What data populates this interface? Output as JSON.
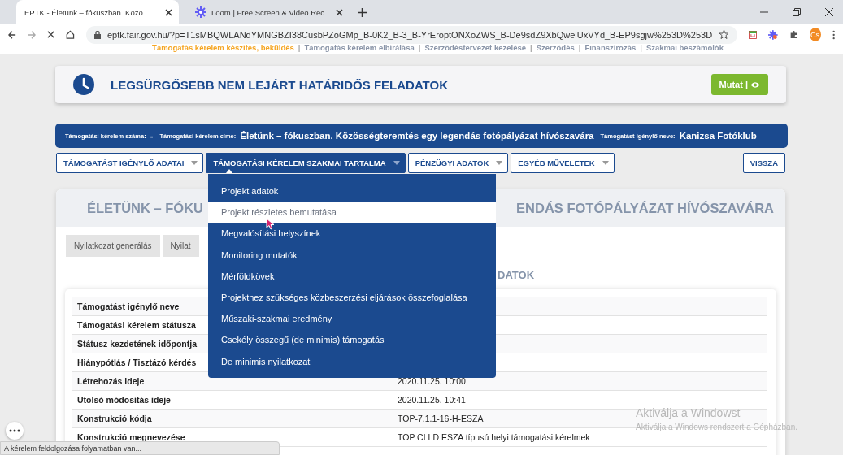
{
  "browser": {
    "tabs": [
      {
        "title": "EPTK - Életünk – fókuszban. Közö",
        "selected": true
      },
      {
        "title": "Loom | Free Screen & Video Rec",
        "selected": false
      }
    ],
    "url": "eptk.fair.gov.hu/?p=T1sMBQWLANdYMNGBZI38CusbPZoGMp_B-0K2_B-3_B-YrEroptONXoZWS_B-De9sdZ9XbQwelUxVYd_B-EP9sgjw%253D%253D",
    "profile": "Cs"
  },
  "nav_separator": "|",
  "nav_links": [
    {
      "label": "Támogatás kérelem készítés, beküldés",
      "selected": true
    },
    {
      "label": "Támogatás kérelem elbírálása",
      "selected": false
    },
    {
      "label": "Szerződéstervezet kezelése",
      "selected": false
    },
    {
      "label": "Szerződés",
      "selected": false
    },
    {
      "label": "Finanszírozás",
      "selected": false
    },
    {
      "label": "Szakmai beszámolók",
      "selected": false
    }
  ],
  "deadlines": {
    "title": "LEGSÜRGŐSEBB NEM LEJÁRT HATÁRIDŐS FELADATOK",
    "button": "Mutat |"
  },
  "info_bar": [
    {
      "label": "Támogatási kérelem száma:",
      "value": "-"
    },
    {
      "label": "Támogatási kérelem címe:",
      "value": "Életünk – fókuszban. Közösségteremtés egy legendás fotópályázat hívószavára"
    },
    {
      "label": "Támogatást igénylő neve:",
      "value": "Kanizsa Fotóklub"
    }
  ],
  "menu_tabs": [
    {
      "label": "TÁMOGATÁST IGÉNYLŐ ADATAI",
      "selected": false
    },
    {
      "label": "TÁMOGATÁSI KÉRELEM SZAKMAI TARTALMA",
      "selected": true
    },
    {
      "label": "PÉNZÜGYI ADATOK",
      "selected": false
    },
    {
      "label": "EGYÉB MŰVELETEK",
      "selected": false
    }
  ],
  "back_button": "VISSZA",
  "dropdown": [
    {
      "label": "Projekt adatok",
      "highlighted": false
    },
    {
      "label": "Projekt részletes bemutatása",
      "highlighted": true
    },
    {
      "label": "Megvalósítási helyszínek",
      "highlighted": false
    },
    {
      "label": "Monitoring mutatók",
      "highlighted": false
    },
    {
      "label": "Mérföldkövek",
      "highlighted": false
    },
    {
      "label": "Projekthez szükséges közbeszerzési eljárások összefoglalása",
      "highlighted": false
    },
    {
      "label": "Műszaki-szakmai eredmény",
      "highlighted": false
    },
    {
      "label": "Csekély összegű (de minimis) támogatás",
      "highlighted": false
    },
    {
      "label": "De minimis nyilatkozat",
      "highlighted": false
    }
  ],
  "main": {
    "title_start": "ÉLETÜNK – FÓKU",
    "title_end": "ENDÁS FOTÓPÁLYÁZAT HÍVÓSZAVÁRA",
    "sub_tabs": [
      "Nyilatkozat generálás",
      "Nyilat"
    ],
    "section_heading": "DATOK",
    "rows": [
      {
        "label": "Támogatást igénylő neve"
      },
      {
        "label": "Támogatási kérelem státusza"
      },
      {
        "label": "Státusz kezdetének időpontja"
      },
      {
        "label": "Hiánypótlás / Tisztázó kérdés"
      },
      {
        "label": "Létrehozás ideje",
        "value": "2020.11.25. 10:00"
      },
      {
        "label": "Utolsó módosítás ideje",
        "value": "2020.11.25. 10:41"
      },
      {
        "label": "Konstrukció kódja",
        "value": "TOP-7.1.1-16-H-ESZA"
      },
      {
        "label": "Konstrukció megnevezése",
        "value": "TOP CLLD ESZA típusú helyi támogatási kérelmek"
      }
    ]
  },
  "status_text": "A kérelem feldolgozása folyamatban van...",
  "os_notice": {
    "title": "Aktiválja a Windowst",
    "text": "Aktiválja a Windows rendszert a Gépházban."
  }
}
